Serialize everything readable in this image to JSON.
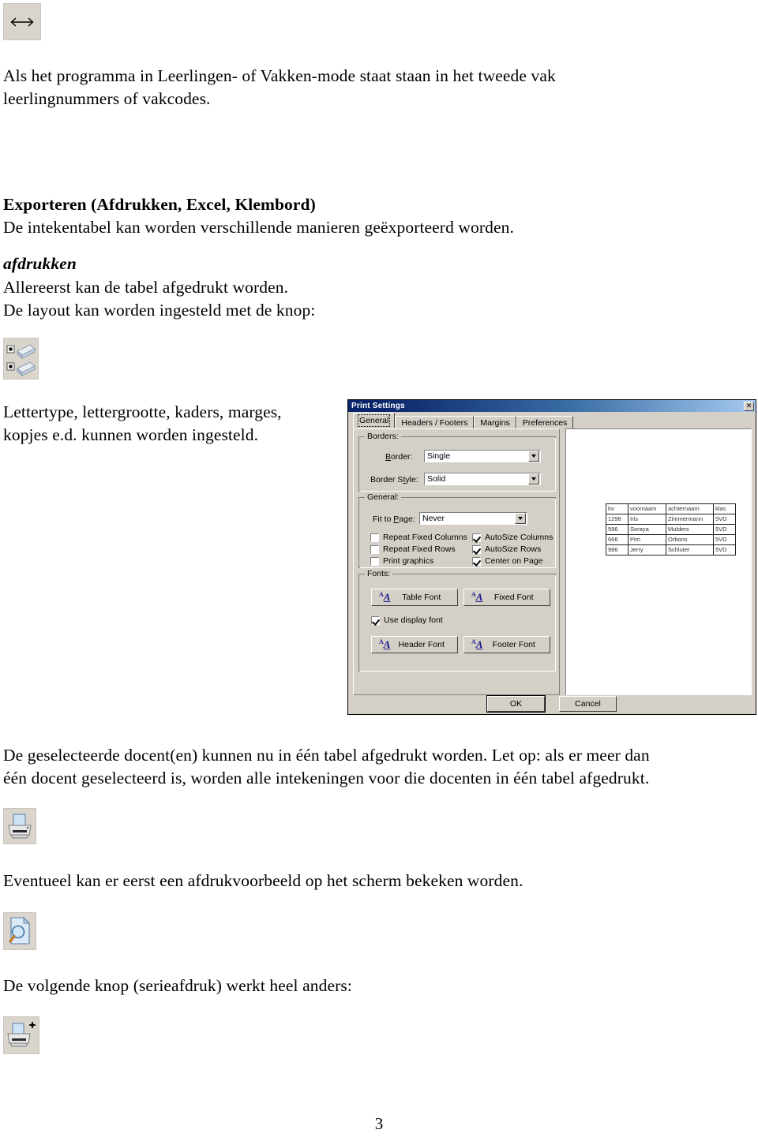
{
  "document": {
    "page_number": "3",
    "paragraphs": [
      {
        "id": "intro",
        "lines": [
          "Als het programma in Leerlingen- of Vakken-mode staat staan in het tweede vak",
          "leerlingnummers of vakcodes."
        ]
      },
      {
        "id": "export-heading",
        "text": "Exporteren (Afdrukken, Excel, Klembord)"
      },
      {
        "id": "export-sub",
        "text": "De intekentabel kan worden verschillende manieren geëxporteerd worden."
      },
      {
        "id": "afdrukken-heading",
        "text": "afdrukken"
      },
      {
        "id": "afdrukken-line1",
        "text": "Allereerst kan de tabel afgedrukt worden."
      },
      {
        "id": "afdrukken-line2",
        "text": "De layout kan worden ingesteld met de knop:"
      },
      {
        "id": "lettertype",
        "lines": [
          "Lettertype, lettergrootte, kaders, marges,",
          "kopjes e.d. kunnen worden ingesteld."
        ]
      },
      {
        "id": "docent-note",
        "lines": [
          "De geselecteerde docent(en) kunnen nu in één tabel afgedrukt worden. Let op: als er meer dan",
          "één docent geselecteerd is, worden alle intekeningen voor die docenten in één tabel afgedrukt."
        ]
      },
      {
        "id": "preview-note",
        "text": "Eventueel kan er eerst een afdrukvoorbeeld op het scherm bekeken worden."
      },
      {
        "id": "serieafdruk-note",
        "text": "De volgende knop (serieafdruk) werkt heel anders:"
      }
    ]
  },
  "icon_buttons": [
    {
      "id": "resize-columns",
      "icon": "horizontal-resize-arrow-icon"
    },
    {
      "id": "page-setup",
      "icon": "page-layout-icon"
    },
    {
      "id": "print",
      "icon": "printer-icon"
    },
    {
      "id": "print-preview",
      "icon": "print-preview-icon"
    },
    {
      "id": "series-print",
      "icon": "printer-plus-icon",
      "badge": "+"
    }
  ],
  "dialog": {
    "title": "Print Settings",
    "close_label": "✕",
    "tabs": [
      {
        "label": "General",
        "active": true
      },
      {
        "label": "Headers / Footers",
        "active": false
      },
      {
        "label": "Margins",
        "active": false
      },
      {
        "label": "Preferences",
        "active": false
      }
    ],
    "borders_group": {
      "title": "Borders:",
      "border_label": "Border:",
      "border_value": "Single",
      "border_style_label": "Border Style:",
      "border_style_value": "Solid"
    },
    "general_group": {
      "title": "General:",
      "fit_label": "Fit to Page:",
      "fit_value": "Never",
      "checkboxes_left": [
        {
          "label": "Repeat Fixed Columns",
          "checked": false
        },
        {
          "label": "Repeat Fixed Rows",
          "checked": false
        },
        {
          "label": "Print graphics",
          "checked": false
        }
      ],
      "checkboxes_right": [
        {
          "label": "AutoSize Columns",
          "checked": true
        },
        {
          "label": "AutoSize Rows",
          "checked": true
        },
        {
          "label": "Center on Page",
          "checked": true
        }
      ]
    },
    "fonts_group": {
      "title": "Fonts:",
      "table_font": "Table Font",
      "fixed_font": "Fixed Font",
      "use_display_font": {
        "label": "Use display font",
        "checked": true
      },
      "header_font": "Header Font",
      "footer_font": "Footer Font"
    },
    "preview": {
      "columns": [
        "lnr",
        "voornaam",
        "achternaam",
        "klas"
      ],
      "rows": [
        [
          "1298",
          "Iris",
          "Zimmermann",
          "5VD"
        ],
        [
          "596",
          "Soraya",
          "Mulders",
          "5VD"
        ],
        [
          "666",
          "Pim",
          "Orbons",
          "5VD"
        ],
        [
          "986",
          "Jerry",
          "Schluter",
          "5VD"
        ]
      ]
    },
    "buttons": {
      "ok": "OK",
      "cancel": "Cancel"
    }
  },
  "colors": {
    "dialog_face": "#d4d0c8",
    "titlebar_start": "#0a246a",
    "titlebar_end": "#a6caf0",
    "icon_button_face": "#d9d5cc",
    "font_glyph": "#1a1a8c"
  }
}
